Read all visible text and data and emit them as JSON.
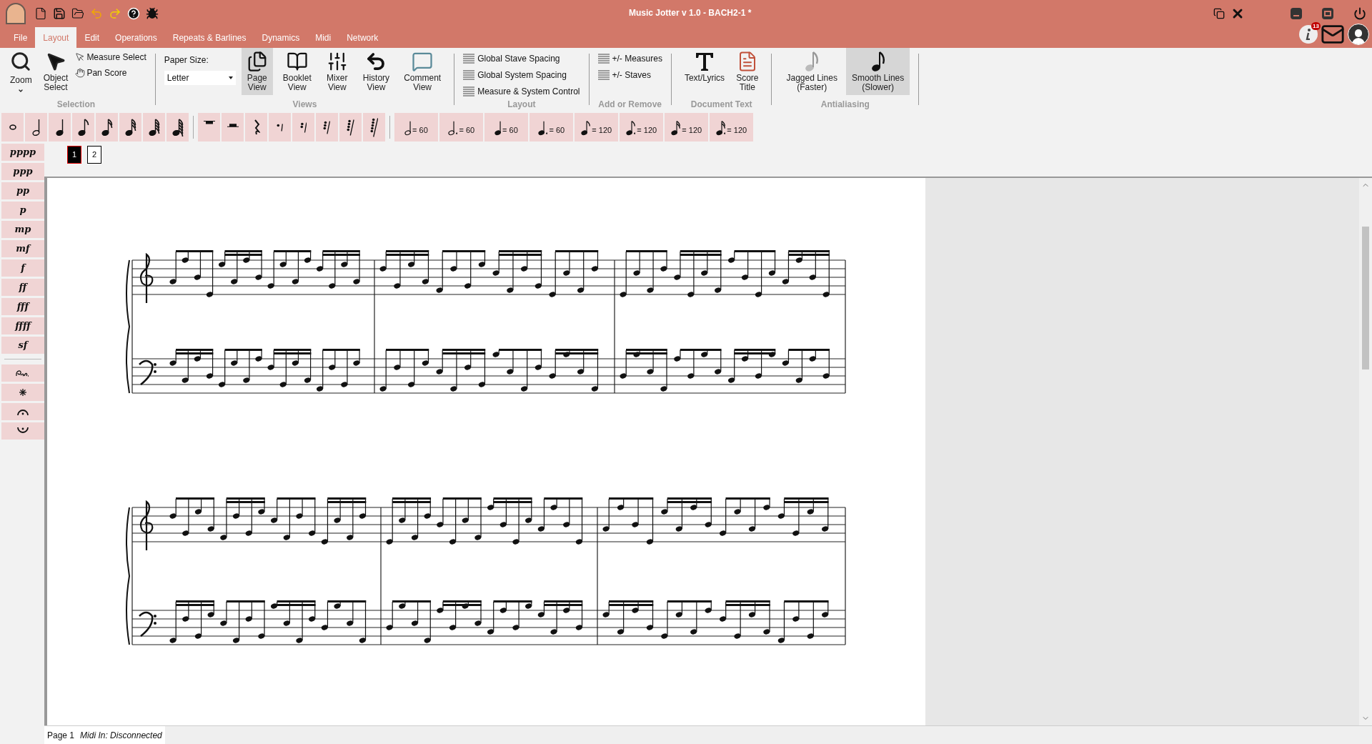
{
  "window": {
    "title": "Music Jotter v 1.0 - BACH2-1 *",
    "notification_count": "13"
  },
  "menu_tabs": [
    {
      "label": "File",
      "selected": false
    },
    {
      "label": "Layout",
      "selected": true
    },
    {
      "label": "Edit",
      "selected": false
    },
    {
      "label": "Operations",
      "selected": false
    },
    {
      "label": "Repeats & Barlines",
      "selected": false
    },
    {
      "label": "Dynamics",
      "selected": false
    },
    {
      "label": "Midi",
      "selected": false
    },
    {
      "label": "Network",
      "selected": false
    }
  ],
  "ribbon": {
    "selection": {
      "label": "Selection",
      "zoom": "Zoom",
      "object_select": "Object\nSelect",
      "measure_select": "Measure Select",
      "pan_score": "Pan Score"
    },
    "paper": {
      "label": "Paper Size:",
      "value": "Letter"
    },
    "views": {
      "label": "Views",
      "buttons": [
        {
          "label": "Page\nView",
          "selected": true
        },
        {
          "label": "Booklet\nView",
          "selected": false
        },
        {
          "label": "Mixer\nView",
          "selected": false
        },
        {
          "label": "History\nView",
          "selected": false
        },
        {
          "label": "Comment\nView",
          "selected": false
        }
      ]
    },
    "layout": {
      "label": "Layout",
      "items": [
        "Global Stave Spacing",
        "Global System Spacing",
        "Measure & System Control"
      ]
    },
    "add_remove": {
      "label": "Add or Remove",
      "items": [
        "+/- Measures",
        "+/- Staves"
      ]
    },
    "document_text": {
      "label": "Document Text",
      "buttons": [
        "Text/Lyrics",
        "Score\nTitle"
      ]
    },
    "antialiasing": {
      "label": "Antialiasing",
      "buttons": [
        {
          "label": "Jagged Lines\n(Faster)",
          "selected": false
        },
        {
          "label": "Smooth Lines\n(Slower)",
          "selected": true
        }
      ]
    }
  },
  "tempo_buttons": [
    {
      "kind": "half",
      "text": "= 60"
    },
    {
      "kind": "dotted_half",
      "text": "= 60"
    },
    {
      "kind": "quarter",
      "text": "= 60"
    },
    {
      "kind": "dotted_quarter",
      "text": "= 60"
    },
    {
      "kind": "eighth",
      "text": "= 120"
    },
    {
      "kind": "dotted_eighth",
      "text": "= 120"
    },
    {
      "kind": "sixteenth",
      "text": "= 120"
    },
    {
      "kind": "dotted_sixteenth",
      "text": "= 120"
    }
  ],
  "dynamics": [
    "pppp",
    "ppp",
    "pp",
    "p",
    "mp",
    "mf",
    "f",
    "ff",
    "fff",
    "ffff",
    "sf"
  ],
  "page_tabs": [
    {
      "label": "1",
      "selected": true
    },
    {
      "label": "2",
      "selected": false
    }
  ],
  "status_bar": {
    "page": "Page 1",
    "midi": "Midi In: Disconnected"
  }
}
